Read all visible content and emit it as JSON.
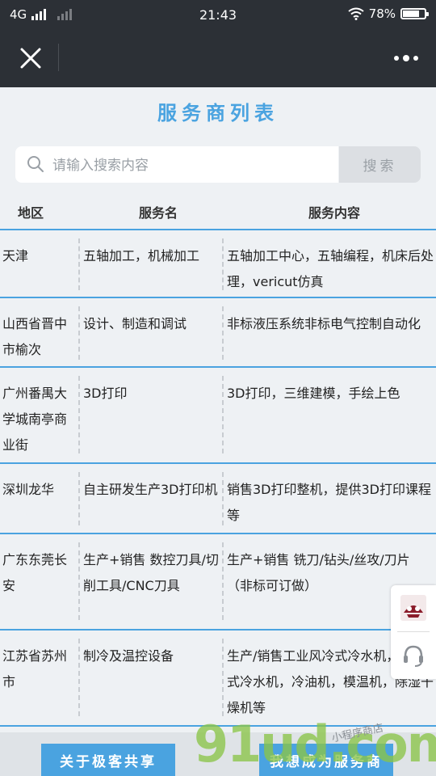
{
  "status_bar": {
    "network": "4G",
    "time": "21:43",
    "battery": "78%",
    "battery_level": 0.78
  },
  "nav": {
    "close_icon": "close-icon",
    "more_icon": "more-dots-icon"
  },
  "page": {
    "title": "服务商列表"
  },
  "search": {
    "placeholder": "请输入搜索内容",
    "value": "",
    "button_label": "搜索"
  },
  "table": {
    "headers": [
      "地区",
      "服务名",
      "服务内容"
    ],
    "rows": [
      {
        "region": "天津",
        "service": "五轴加工，机械加工",
        "content": "五轴加工中心，五轴编程，机床后处理，vericut仿真"
      },
      {
        "region": "山西省晋中市榆次",
        "service": "设计、制造和调试",
        "content": "非标液压系统非标电气控制自动化"
      },
      {
        "region": "广州番禺大学城南亭商业街",
        "service": "3D打印",
        "content": "3D打印，三维建模，手绘上色"
      },
      {
        "region": "深圳龙华",
        "service": "自主研发生产3D打印机",
        "content": "销售3D打印整机，提供3D打印课程等"
      },
      {
        "region": "广东东莞长安",
        "service": "生产+销售 数控刀具/切削工具/CNC刀具",
        "content": "生产+销售 铣刀/钻头/丝攻/刀片（非标可订做）"
      },
      {
        "region": "江苏省苏州市",
        "service": "制冷及温控设备",
        "content": "生产/销售工业风冷式冷水机，水冷式冷水机，冷油机，模温机，除湿干燥机等"
      }
    ]
  },
  "side_panel": {
    "logo_icon": "app-logo-icon",
    "support_icon": "headset-icon"
  },
  "bottom": {
    "about_label": "关于极客共享",
    "join_label": "我想成为服务商"
  },
  "watermark": {
    "text": "91ud.com",
    "sub": "小程序商店"
  },
  "colors": {
    "accent": "#4aa3e0",
    "topbar": "#2c3036",
    "background": "#eef1f4"
  }
}
